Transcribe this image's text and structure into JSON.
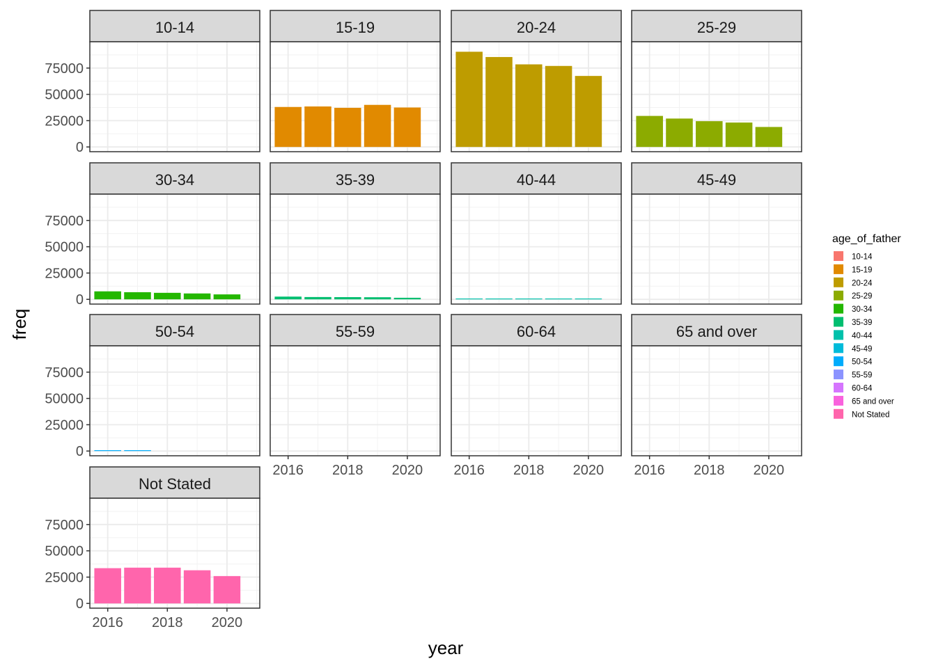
{
  "chart_data": {
    "type": "bar",
    "facet_by": "age_of_father",
    "xlabel": "year",
    "ylabel": "freq",
    "x": [
      2016,
      2017,
      2018,
      2019,
      2020
    ],
    "xlim": [
      2015.4,
      2021.1
    ],
    "ylim": [
      -4500,
      100000
    ],
    "x_ticks": [
      2016,
      2018,
      2020
    ],
    "y_ticks": [
      0,
      25000,
      50000,
      75000
    ],
    "grid": true,
    "legend": {
      "title": "age_of_father",
      "position": "right"
    },
    "series": [
      {
        "name": "10-14",
        "color": "#F8766D",
        "values": [
          0,
          0,
          0,
          0,
          0
        ]
      },
      {
        "name": "15-19",
        "color": "#E18A00",
        "values": [
          38000,
          38500,
          37200,
          40000,
          37500
        ]
      },
      {
        "name": "20-24",
        "color": "#BE9C00",
        "values": [
          90500,
          85500,
          78500,
          77000,
          67500
        ]
      },
      {
        "name": "25-29",
        "color": "#8CAB00",
        "values": [
          29500,
          27000,
          24500,
          23200,
          19000
        ]
      },
      {
        "name": "30-34",
        "color": "#24B700",
        "values": [
          7600,
          6800,
          6200,
          5600,
          4700
        ]
      },
      {
        "name": "35-39",
        "color": "#00BE70",
        "values": [
          2600,
          2200,
          2100,
          2000,
          1500
        ]
      },
      {
        "name": "40-44",
        "color": "#00C1AB",
        "values": [
          500,
          450,
          400,
          400,
          350
        ]
      },
      {
        "name": "45-49",
        "color": "#00BBDA",
        "values": [
          0,
          0,
          0,
          0,
          0
        ]
      },
      {
        "name": "50-54",
        "color": "#00ACFC",
        "values": [
          300,
          250,
          0,
          0,
          0
        ]
      },
      {
        "name": "55-59",
        "color": "#8B93FF",
        "values": [
          0,
          0,
          0,
          0,
          0
        ]
      },
      {
        "name": "60-64",
        "color": "#D575FE",
        "values": [
          0,
          0,
          0,
          0,
          0
        ]
      },
      {
        "name": "65 and over",
        "color": "#F962DD",
        "values": [
          0,
          0,
          0,
          0,
          0
        ]
      },
      {
        "name": "Not Stated",
        "color": "#FF65AC",
        "values": [
          33500,
          34000,
          34000,
          31500,
          26000
        ]
      }
    ]
  }
}
